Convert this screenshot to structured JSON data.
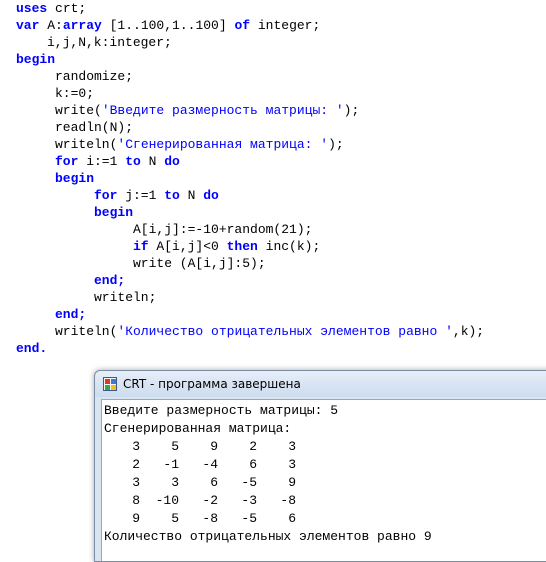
{
  "editor": {
    "lines": [
      {
        "indent": 2,
        "tokens": [
          {
            "t": "uses",
            "c": "kw"
          },
          {
            "t": " crt;",
            "c": "ident"
          }
        ]
      },
      {
        "indent": 2,
        "tokens": [
          {
            "t": "var",
            "c": "kw"
          },
          {
            "t": " A:",
            "c": "ident"
          },
          {
            "t": "array",
            "c": "kw"
          },
          {
            "t": " [1..100,1..100] ",
            "c": "ident"
          },
          {
            "t": "of",
            "c": "kw"
          },
          {
            "t": " integer;",
            "c": "ident"
          }
        ]
      },
      {
        "indent": 6,
        "tokens": [
          {
            "t": "i,j,N,k:integer;",
            "c": "ident"
          }
        ]
      },
      {
        "indent": 2,
        "tokens": [
          {
            "t": "begin",
            "c": "kw"
          }
        ]
      },
      {
        "indent": 7,
        "tokens": [
          {
            "t": "randomize;",
            "c": "ident"
          }
        ]
      },
      {
        "indent": 7,
        "tokens": [
          {
            "t": "k:=0;",
            "c": "ident"
          }
        ]
      },
      {
        "indent": 7,
        "tokens": [
          {
            "t": "write(",
            "c": "ident"
          },
          {
            "t": "'Введите размерность матрицы: '",
            "c": "str"
          },
          {
            "t": ");",
            "c": "ident"
          }
        ]
      },
      {
        "indent": 7,
        "tokens": [
          {
            "t": "readln(N);",
            "c": "ident"
          }
        ]
      },
      {
        "indent": 7,
        "tokens": [
          {
            "t": "writeln(",
            "c": "ident"
          },
          {
            "t": "'Сгенерированная матрица: '",
            "c": "str"
          },
          {
            "t": ");",
            "c": "ident"
          }
        ]
      },
      {
        "indent": 7,
        "tokens": [
          {
            "t": "for",
            "c": "kw"
          },
          {
            "t": " i:=1 ",
            "c": "ident"
          },
          {
            "t": "to",
            "c": "kw"
          },
          {
            "t": " N ",
            "c": "ident"
          },
          {
            "t": "do",
            "c": "kw"
          }
        ]
      },
      {
        "indent": 7,
        "tokens": [
          {
            "t": "begin",
            "c": "kw"
          }
        ]
      },
      {
        "indent": 12,
        "tokens": [
          {
            "t": "for",
            "c": "kw"
          },
          {
            "t": " j:=1 ",
            "c": "ident"
          },
          {
            "t": "to",
            "c": "kw"
          },
          {
            "t": " N ",
            "c": "ident"
          },
          {
            "t": "do",
            "c": "kw"
          }
        ]
      },
      {
        "indent": 12,
        "tokens": [
          {
            "t": "begin",
            "c": "kw"
          }
        ]
      },
      {
        "indent": 17,
        "tokens": [
          {
            "t": "A[i,j]:=-10+random(21);",
            "c": "ident"
          }
        ]
      },
      {
        "indent": 17,
        "tokens": [
          {
            "t": "if",
            "c": "kw"
          },
          {
            "t": " A[i,j]<0 ",
            "c": "ident"
          },
          {
            "t": "then",
            "c": "kw"
          },
          {
            "t": " inc(k);",
            "c": "ident"
          }
        ]
      },
      {
        "indent": 17,
        "tokens": [
          {
            "t": "write (A[i,j]:5);",
            "c": "ident"
          }
        ]
      },
      {
        "indent": 12,
        "tokens": [
          {
            "t": "end;",
            "c": "kw"
          }
        ]
      },
      {
        "indent": 12,
        "tokens": [
          {
            "t": "writeln;",
            "c": "ident"
          }
        ]
      },
      {
        "indent": 7,
        "tokens": [
          {
            "t": "end;",
            "c": "kw"
          }
        ]
      },
      {
        "indent": 7,
        "tokens": [
          {
            "t": "writeln(",
            "c": "ident"
          },
          {
            "t": "'Количество отрицательных элементов равно '",
            "c": "str"
          },
          {
            "t": ",k);",
            "c": "ident"
          }
        ]
      },
      {
        "indent": 2,
        "tokens": [
          {
            "t": "end.",
            "c": "kw"
          }
        ]
      }
    ]
  },
  "console": {
    "title": "CRT - программа завершена",
    "prompt_line": "Введите размерность матрицы: 5",
    "matrix_header": "Сгенерированная матрица:",
    "matrix": [
      [
        3,
        5,
        9,
        2,
        3
      ],
      [
        2,
        -1,
        -4,
        6,
        3
      ],
      [
        3,
        3,
        6,
        -5,
        9
      ],
      [
        8,
        -10,
        -2,
        -3,
        -8
      ],
      [
        9,
        5,
        -8,
        -5,
        6
      ]
    ],
    "result_line": "Количество отрицательных элементов равно 9"
  },
  "colors": {
    "keyword": "#0000ff",
    "string": "#0000ff",
    "text": "#000000"
  },
  "icons": {
    "app_icon": "crt-app-icon"
  }
}
